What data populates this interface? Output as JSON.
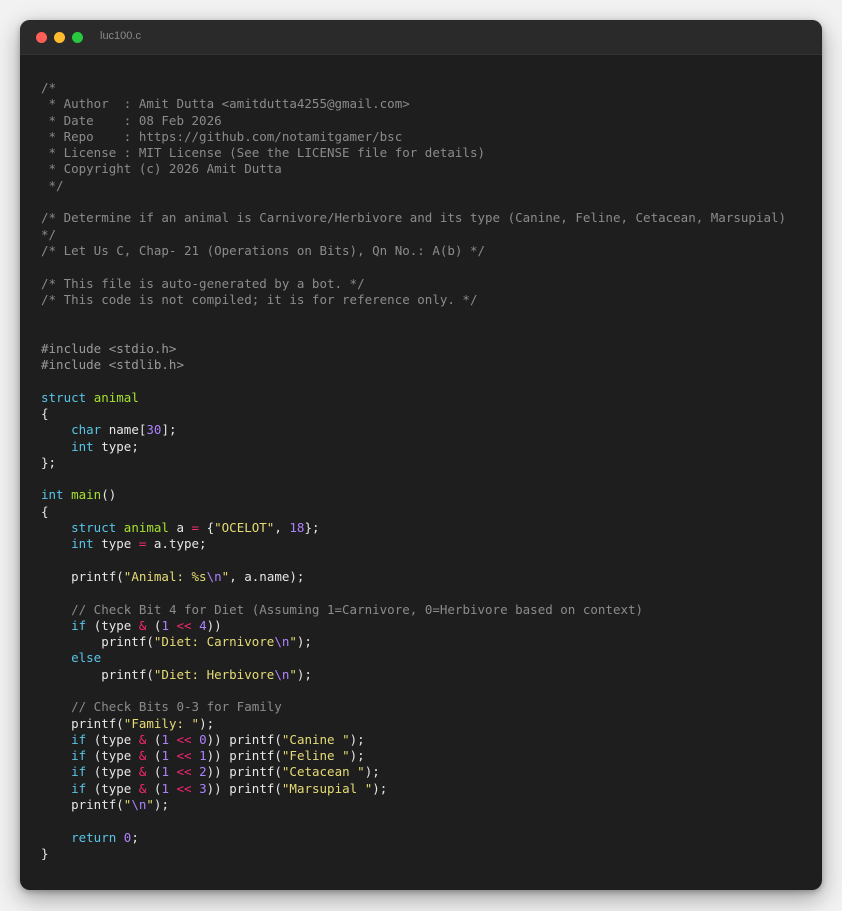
{
  "window": {
    "title": "luc100.c",
    "colors": {
      "red": "#ff5f57",
      "yellow": "#febc2e",
      "green": "#28c840",
      "background": "#1e1e1e"
    }
  },
  "code_lines": [
    [
      [
        "comment",
        "/*"
      ]
    ],
    [
      [
        "comment",
        " * Author  : Amit Dutta <amitdutta4255@gmail.com>"
      ]
    ],
    [
      [
        "comment",
        " * Date    : 08 Feb 2026"
      ]
    ],
    [
      [
        "comment",
        " * Repo    : https://github.com/notamitgamer/bsc"
      ]
    ],
    [
      [
        "comment",
        " * License : MIT License (See the LICENSE file for details)"
      ]
    ],
    [
      [
        "comment",
        " * Copyright (c) 2026 Amit Dutta"
      ]
    ],
    [
      [
        "comment",
        " */"
      ]
    ],
    [],
    [
      [
        "comment",
        "/* Determine if an animal is Carnivore/Herbivore and its type (Canine, Feline, Cetacean, Marsupial)"
      ]
    ],
    [
      [
        "comment",
        "*/"
      ]
    ],
    [
      [
        "comment",
        "/* Let Us C, Chap- 21 (Operations on Bits), Qn No.: A(b) */"
      ]
    ],
    [],
    [
      [
        "comment",
        "/* This file is auto-generated by a bot. */"
      ]
    ],
    [
      [
        "comment",
        "/* This code is not compiled; it is for reference only. */"
      ]
    ],
    [],
    [],
    [
      [
        "pre",
        "#include <stdio.h>"
      ]
    ],
    [
      [
        "pre",
        "#include <stdlib.h>"
      ]
    ],
    [],
    [
      [
        "kw",
        "struct"
      ],
      [
        "plain",
        " "
      ],
      [
        "type",
        "animal"
      ]
    ],
    [
      [
        "plain",
        "{"
      ]
    ],
    [
      [
        "plain",
        "    "
      ],
      [
        "kw",
        "char"
      ],
      [
        "plain",
        " name["
      ],
      [
        "num",
        "30"
      ],
      [
        "plain",
        "];"
      ]
    ],
    [
      [
        "plain",
        "    "
      ],
      [
        "kw",
        "int"
      ],
      [
        "plain",
        " type;"
      ]
    ],
    [
      [
        "plain",
        "};"
      ]
    ],
    [],
    [
      [
        "kw",
        "int"
      ],
      [
        "plain",
        " "
      ],
      [
        "fn",
        "main"
      ],
      [
        "plain",
        "()"
      ]
    ],
    [
      [
        "plain",
        "{"
      ]
    ],
    [
      [
        "plain",
        "    "
      ],
      [
        "kw",
        "struct"
      ],
      [
        "plain",
        " "
      ],
      [
        "type",
        "animal"
      ],
      [
        "plain",
        " a "
      ],
      [
        "op",
        "="
      ],
      [
        "plain",
        " {"
      ],
      [
        "str",
        "\"OCELOT\""
      ],
      [
        "plain",
        ", "
      ],
      [
        "num",
        "18"
      ],
      [
        "plain",
        "};"
      ]
    ],
    [
      [
        "plain",
        "    "
      ],
      [
        "kw",
        "int"
      ],
      [
        "plain",
        " type "
      ],
      [
        "op",
        "="
      ],
      [
        "plain",
        " a.type;"
      ]
    ],
    [],
    [
      [
        "plain",
        "    printf("
      ],
      [
        "str",
        "\"Animal: %s"
      ],
      [
        "esc",
        "\\n"
      ],
      [
        "str",
        "\""
      ],
      [
        "plain",
        ", a.name);"
      ]
    ],
    [],
    [
      [
        "plain",
        "    "
      ],
      [
        "comment",
        "// Check Bit 4 for Diet (Assuming 1=Carnivore, 0=Herbivore based on context)"
      ]
    ],
    [
      [
        "plain",
        "    "
      ],
      [
        "kw",
        "if"
      ],
      [
        "plain",
        " (type "
      ],
      [
        "op",
        "&"
      ],
      [
        "plain",
        " ("
      ],
      [
        "num",
        "1"
      ],
      [
        "plain",
        " "
      ],
      [
        "op",
        "<<"
      ],
      [
        "plain",
        " "
      ],
      [
        "num",
        "4"
      ],
      [
        "plain",
        "))"
      ]
    ],
    [
      [
        "plain",
        "        printf("
      ],
      [
        "str",
        "\"Diet: Carnivore"
      ],
      [
        "esc",
        "\\n"
      ],
      [
        "str",
        "\""
      ],
      [
        "plain",
        ");"
      ]
    ],
    [
      [
        "plain",
        "    "
      ],
      [
        "kw",
        "else"
      ]
    ],
    [
      [
        "plain",
        "        printf("
      ],
      [
        "str",
        "\"Diet: Herbivore"
      ],
      [
        "esc",
        "\\n"
      ],
      [
        "str",
        "\""
      ],
      [
        "plain",
        ");"
      ]
    ],
    [],
    [
      [
        "plain",
        "    "
      ],
      [
        "comment",
        "// Check Bits 0-3 for Family"
      ]
    ],
    [
      [
        "plain",
        "    printf("
      ],
      [
        "str",
        "\"Family: \""
      ],
      [
        "plain",
        ");"
      ]
    ],
    [
      [
        "plain",
        "    "
      ],
      [
        "kw",
        "if"
      ],
      [
        "plain",
        " (type "
      ],
      [
        "op",
        "&"
      ],
      [
        "plain",
        " ("
      ],
      [
        "num",
        "1"
      ],
      [
        "plain",
        " "
      ],
      [
        "op",
        "<<"
      ],
      [
        "plain",
        " "
      ],
      [
        "num",
        "0"
      ],
      [
        "plain",
        ")) printf("
      ],
      [
        "str",
        "\"Canine \""
      ],
      [
        "plain",
        ");"
      ]
    ],
    [
      [
        "plain",
        "    "
      ],
      [
        "kw",
        "if"
      ],
      [
        "plain",
        " (type "
      ],
      [
        "op",
        "&"
      ],
      [
        "plain",
        " ("
      ],
      [
        "num",
        "1"
      ],
      [
        "plain",
        " "
      ],
      [
        "op",
        "<<"
      ],
      [
        "plain",
        " "
      ],
      [
        "num",
        "1"
      ],
      [
        "plain",
        ")) printf("
      ],
      [
        "str",
        "\"Feline \""
      ],
      [
        "plain",
        ");"
      ]
    ],
    [
      [
        "plain",
        "    "
      ],
      [
        "kw",
        "if"
      ],
      [
        "plain",
        " (type "
      ],
      [
        "op",
        "&"
      ],
      [
        "plain",
        " ("
      ],
      [
        "num",
        "1"
      ],
      [
        "plain",
        " "
      ],
      [
        "op",
        "<<"
      ],
      [
        "plain",
        " "
      ],
      [
        "num",
        "2"
      ],
      [
        "plain",
        ")) printf("
      ],
      [
        "str",
        "\"Cetacean \""
      ],
      [
        "plain",
        ");"
      ]
    ],
    [
      [
        "plain",
        "    "
      ],
      [
        "kw",
        "if"
      ],
      [
        "plain",
        " (type "
      ],
      [
        "op",
        "&"
      ],
      [
        "plain",
        " ("
      ],
      [
        "num",
        "1"
      ],
      [
        "plain",
        " "
      ],
      [
        "op",
        "<<"
      ],
      [
        "plain",
        " "
      ],
      [
        "num",
        "3"
      ],
      [
        "plain",
        ")) printf("
      ],
      [
        "str",
        "\"Marsupial \""
      ],
      [
        "plain",
        ");"
      ]
    ],
    [
      [
        "plain",
        "    printf("
      ],
      [
        "str",
        "\""
      ],
      [
        "esc",
        "\\n"
      ],
      [
        "str",
        "\""
      ],
      [
        "plain",
        ");"
      ]
    ],
    [],
    [
      [
        "plain",
        "    "
      ],
      [
        "kw",
        "return"
      ],
      [
        "plain",
        " "
      ],
      [
        "num",
        "0"
      ],
      [
        "plain",
        ";"
      ]
    ],
    [
      [
        "plain",
        "}"
      ]
    ]
  ]
}
